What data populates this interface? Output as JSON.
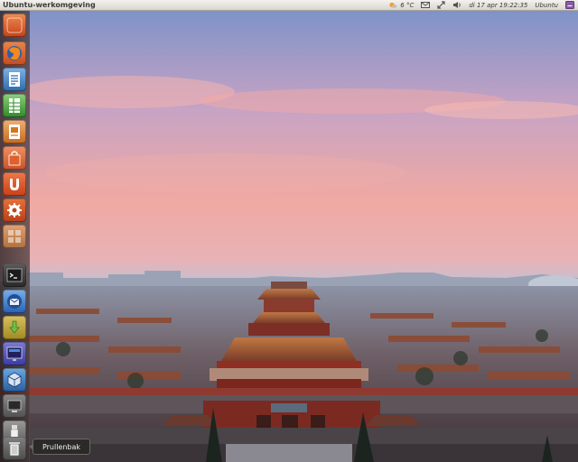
{
  "top_panel": {
    "app_title": "Ubuntu-werkomgeving",
    "weather": "6 °C",
    "clock": "di 17 apr 19:22:35",
    "user": "Ubuntu"
  },
  "launcher": {
    "items": [
      {
        "name": "dash-home",
        "icon": "dash-icon"
      },
      {
        "name": "firefox",
        "icon": "firefox-icon"
      },
      {
        "name": "writer",
        "icon": "libreoffice-writer-icon"
      },
      {
        "name": "calc",
        "icon": "libreoffice-calc-icon"
      },
      {
        "name": "impress",
        "icon": "libreoffice-impress-icon"
      },
      {
        "name": "software-center",
        "icon": "shopping-bag-icon"
      },
      {
        "name": "ubuntu-one",
        "icon": "ubuntu-one-icon"
      },
      {
        "name": "system-settings",
        "icon": "settings-gear-icon"
      },
      {
        "name": "workspace-switcher",
        "icon": "workspaces-icon"
      },
      {
        "name": "terminal",
        "icon": "terminal-icon"
      },
      {
        "name": "thunderbird",
        "icon": "thunderbird-icon"
      },
      {
        "name": "update-manager",
        "icon": "download-arrow-icon"
      },
      {
        "name": "monitor",
        "icon": "monitor-icon"
      },
      {
        "name": "virtualbox",
        "icon": "cube-icon"
      },
      {
        "name": "display",
        "icon": "display-icon"
      },
      {
        "name": "usb-drive",
        "icon": "usb-icon"
      },
      {
        "name": "trash",
        "icon": "trash-icon"
      }
    ],
    "tooltip": "Prullenbak"
  },
  "colors": {
    "panel": "#dfdbd2",
    "launcher": "#3b2d2d",
    "accent": "#dd4814"
  }
}
